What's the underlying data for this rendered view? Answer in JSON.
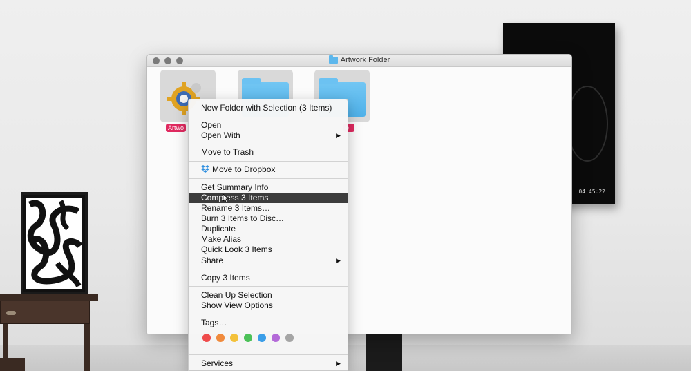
{
  "window": {
    "title": "Artwork Folder",
    "items": [
      {
        "label": "Artwo",
        "kind": "app"
      },
      {
        "label": "",
        "kind": "folder"
      },
      {
        "label": "e",
        "kind": "folder"
      }
    ]
  },
  "menu": {
    "new_folder": "New Folder with Selection (3 Items)",
    "open": "Open",
    "open_with": "Open With",
    "move_to_trash": "Move to Trash",
    "move_to_dropbox": "Move to Dropbox",
    "get_summary_info": "Get Summary Info",
    "compress": "Compress 3 Items",
    "rename": "Rename 3 Items…",
    "burn": "Burn 3 Items to Disc…",
    "duplicate": "Duplicate",
    "make_alias": "Make Alias",
    "quick_look": "Quick Look 3 Items",
    "share": "Share",
    "copy": "Copy 3 Items",
    "clean_up": "Clean Up Selection",
    "show_view_options": "Show View Options",
    "tags": "Tags…",
    "services": "Services",
    "submenu_arrow": "▶",
    "tag_colors": [
      "#ef4b4b",
      "#f08a3c",
      "#f3c13a",
      "#4cc158",
      "#3b9ee8",
      "#b36ad8",
      "#a5a5a5"
    ]
  },
  "background": {
    "clock": "04:45:22"
  }
}
